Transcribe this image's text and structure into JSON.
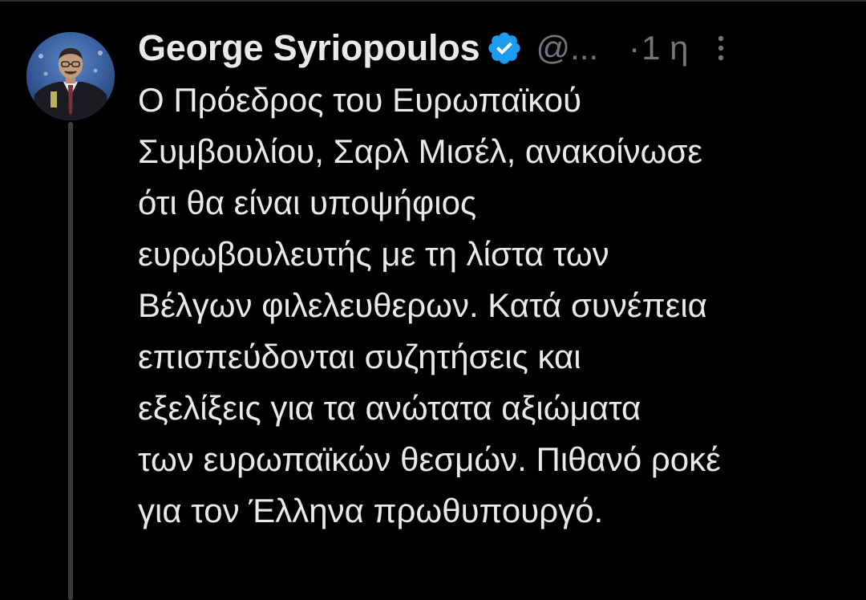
{
  "tweet": {
    "author": {
      "display_name": "George Syriopoulos",
      "handle": "@...",
      "verified": true,
      "avatar_icon": "user-photo-avatar"
    },
    "time_separator": "·",
    "timestamp": "1 η",
    "more_icon": "vertical-ellipsis-icon",
    "text": "Ο Πρόεδρος του Ευρωπαϊκού\nΣυμβουλίου, Σαρλ Μισέλ, ανακοίνωσε\nότι θα είναι υποψήφιος\nευρωβουλευτής με τη λίστα των\nΒέλγων φιλελευθερων. Κατά συνέπεια\nεπισπεύδονται συζητήσεις και\nεξελίξεις για τα ανώτατα αξιώματα\nτων ευρωπαϊκών θεσμών. Πιθανό ροκέ\nγια τον  Έλληνα πρωθυπουργό."
  },
  "colors": {
    "background": "#000000",
    "text_primary": "#e7e9ea",
    "text_secondary": "#71767b",
    "verified_blue": "#1d9bf0",
    "thread_line": "#3a3d40"
  }
}
